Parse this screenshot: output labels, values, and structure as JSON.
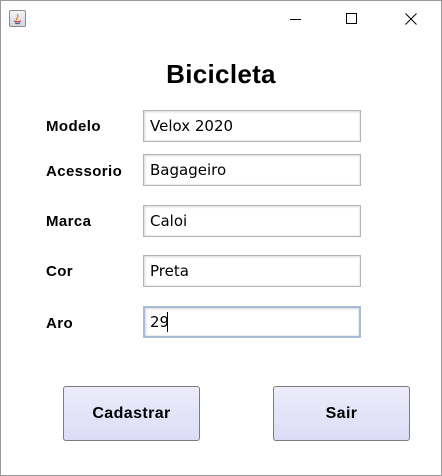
{
  "window": {
    "title_bar_icon": "java-app-icon",
    "controls": {
      "minimize_icon": "minimize-icon",
      "maximize_icon": "maximize-icon",
      "close_icon": "close-icon"
    }
  },
  "form": {
    "title": "Bicicleta",
    "fields": {
      "modelo": {
        "label": "Modelo",
        "value": "Velox 2020"
      },
      "acessorio": {
        "label": "Acessorio",
        "value": "Bagageiro"
      },
      "marca": {
        "label": "Marca",
        "value": "Caloi"
      },
      "cor": {
        "label": "Cor",
        "value": "Preta"
      },
      "aro": {
        "label": "Aro",
        "value": "29"
      }
    },
    "buttons": {
      "cadastrar": "Cadastrar",
      "sair": "Sair"
    },
    "colors": {
      "button_background": "#dcdcf6",
      "focused_field_border": "#a9bcd6"
    }
  }
}
